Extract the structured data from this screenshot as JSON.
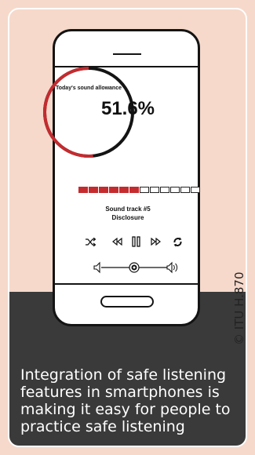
{
  "screen": {
    "allowance_label": "Today's sound allowance",
    "allowance_value": "51.6%",
    "allowance_fraction": 0.516,
    "meter": {
      "total_segments": 12,
      "filled_segments": 6
    },
    "track_title": "Sound track #5",
    "track_artist": "Disclosure"
  },
  "icons": {
    "shuffle": "shuffle-icon",
    "rewind": "rewind-icon",
    "pause": "pause-icon",
    "fast_forward": "fast-forward-icon",
    "repeat": "repeat-icon",
    "volume_low": "volume-low-icon",
    "volume_high": "volume-high-icon"
  },
  "colors": {
    "background": "#f6d9cb",
    "accent": "#c42b2f",
    "caption_bg": "#3a3a3a"
  },
  "caption": "Integration of safe listening features in smartphones is making it easy for people to practice safe listening",
  "credit": "© ITU H.870"
}
